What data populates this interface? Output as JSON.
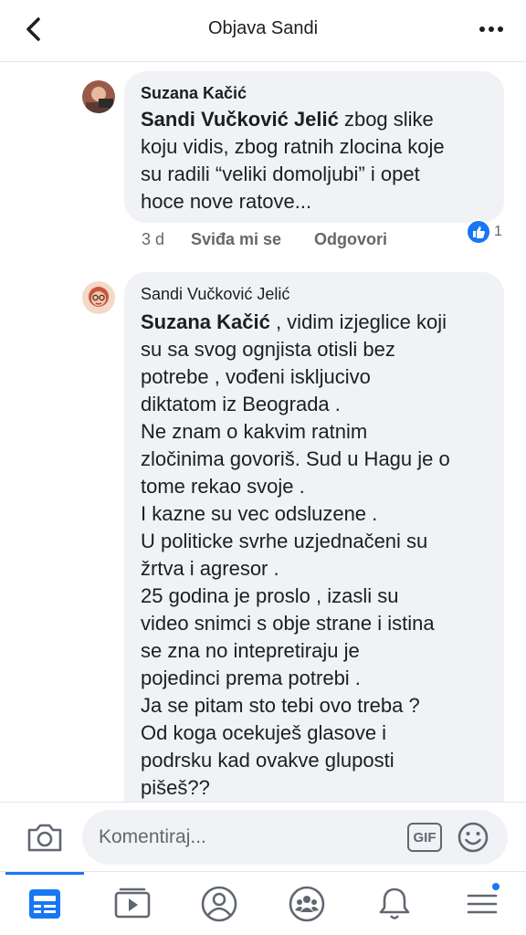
{
  "header": {
    "title": "Objava Sandi",
    "back_icon": "chevron-left-icon",
    "more_icon": "more-horizontal-icon"
  },
  "comments": [
    {
      "author": "Suzana Kačić",
      "mention": "Sandi Vučković Jelić",
      "text": " zbog slike\nkoju vidis, zbog ratnih zlocina koje\nsu radili “veliki domoljubi” i opet\nhoce nove ratove...",
      "time": "3 d",
      "like_label": "Sviđa mi se",
      "reply_label": "Odgovori",
      "reaction_count": "1"
    },
    {
      "author": "Sandi Vučković Jelić",
      "mention": "Suzana Kačić",
      "text": " , vidim izjeglice koji\nsu sa svog ognjista otisli bez\npotrebe , vođeni iskljucivo\ndiktatom iz Beograda .\nNe znam o kakvim ratnim\nzločinima govoriš. Sud u Hagu je o\ntome rekao svoje .\nI kazne su vec odsluzene .\nU politicke svrhe uzjednačeni su\nžrtva i agresor .\n25 godina je proslo , izasli su\nvideo snimci s obje strane i istina\nse zna     no intepretiraju je\npojedinci prema potrebi .\nJa se pitam sto tebi ovo treba ?\nOd koga ocekuješ glasove i\npodrsku kad ovakve gluposti\npišeš??"
    }
  ],
  "composer": {
    "placeholder": "Komentiraj...",
    "gif_label": "GIF",
    "camera_icon": "camera-icon",
    "emoji_icon": "smiley-icon"
  },
  "navbar": {
    "items": [
      "news-feed-icon",
      "watch-icon",
      "profile-icon",
      "groups-icon",
      "notifications-icon",
      "menu-icon"
    ]
  },
  "colors": {
    "accent": "#1877f2",
    "bubble": "#f0f2f5",
    "secondary_text": "#65676b"
  }
}
